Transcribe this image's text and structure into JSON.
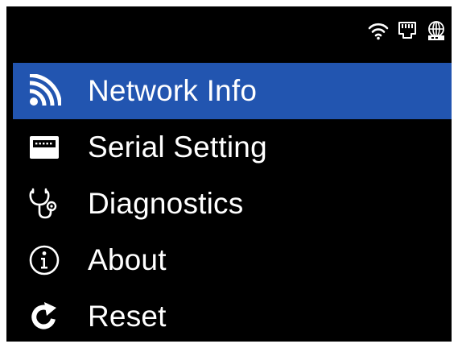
{
  "status_bar": {
    "icons": [
      "wifi-icon",
      "ethernet-icon",
      "internet-globe-icon"
    ]
  },
  "theme": {
    "background": "#000000",
    "selected_background": "#2255b0",
    "text": "#ffffff"
  },
  "menu": {
    "selected_index": 0,
    "items": [
      {
        "label": "Network Info",
        "icon": "wifi-signal-icon"
      },
      {
        "label": "Serial Setting",
        "icon": "serial-port-icon"
      },
      {
        "label": "Diagnostics",
        "icon": "stethoscope-icon"
      },
      {
        "label": "About",
        "icon": "info-icon"
      },
      {
        "label": "Reset",
        "icon": "reset-icon"
      }
    ]
  }
}
